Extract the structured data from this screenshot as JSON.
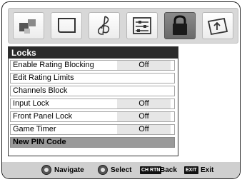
{
  "menu": {
    "title": "Locks",
    "items": [
      {
        "label": "Enable Rating Blocking",
        "value": "Off"
      },
      {
        "label": "Edit Rating Limits",
        "value": ""
      },
      {
        "label": "Channels Block",
        "value": ""
      },
      {
        "label": "Input Lock",
        "value": "Off"
      },
      {
        "label": "Front Panel Lock",
        "value": "Off"
      },
      {
        "label": "Game Timer",
        "value": "Off"
      },
      {
        "label": "New PIN Code",
        "value": ""
      }
    ],
    "highlighted_index": 6
  },
  "icon_strip": {
    "icons": [
      "picture-icon",
      "screen-icon",
      "audio-icon",
      "setup-icon",
      "lock-icon",
      "applications-icon"
    ],
    "selected": "lock-icon"
  },
  "help_bar": {
    "navigate_label": "Navigate",
    "select_label": "Select",
    "back_key": "CH RTN",
    "back_label": "Back",
    "exit_key": "EXIT",
    "exit_label": "Exit"
  }
}
